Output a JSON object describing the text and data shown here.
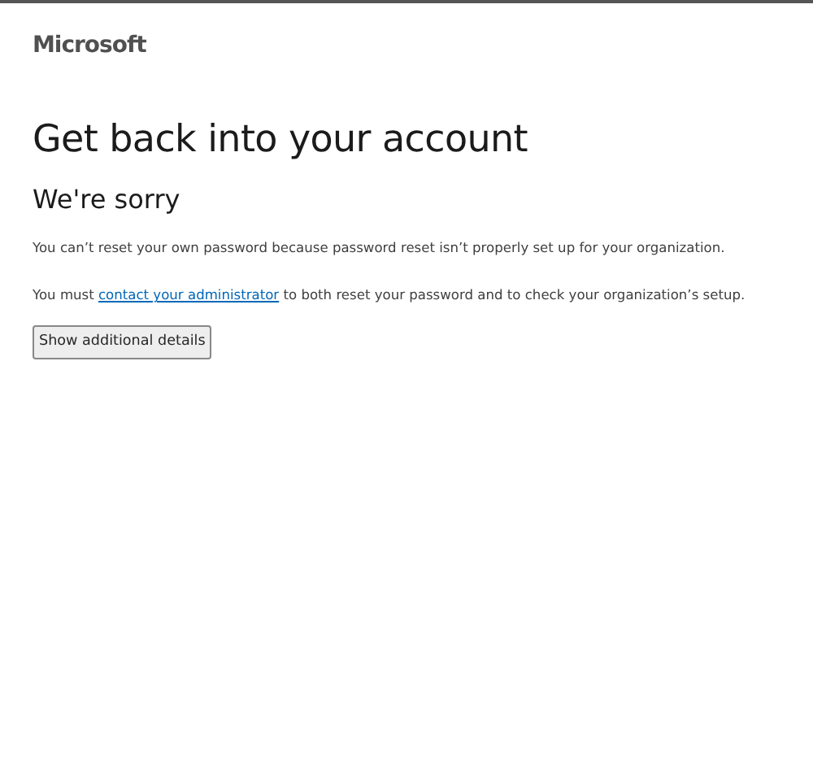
{
  "logo": "Microsoft",
  "title": "Get back into your account",
  "subtitle": "We're sorry",
  "message": "You can’t reset your own password because password reset isn’t properly set up for your organization.",
  "instruction": {
    "before": "You must ",
    "link": "contact your administrator",
    "after": " to both reset your password and to check your organization’s setup."
  },
  "button": "Show additional details"
}
